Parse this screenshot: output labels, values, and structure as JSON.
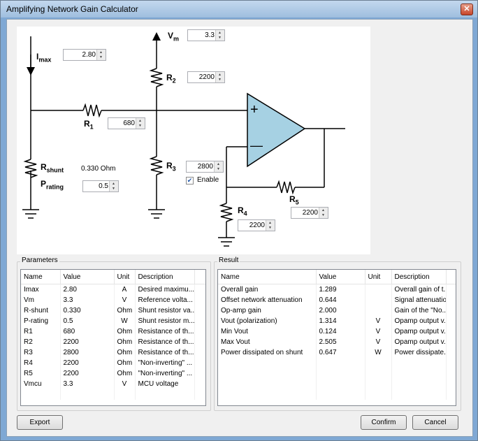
{
  "window": {
    "title": "Amplifying Network Gain Calculator"
  },
  "schematic": {
    "imax": {
      "label": "I",
      "sub": "max",
      "value": "2.80"
    },
    "vm": {
      "label": "V",
      "sub": "m",
      "value": "3.3"
    },
    "r1": {
      "label": "R",
      "sub": "1",
      "value": "680"
    },
    "r2": {
      "label": "R",
      "sub": "2",
      "value": "2200"
    },
    "r3": {
      "label": "R",
      "sub": "3",
      "value": "2800"
    },
    "r4": {
      "label": "R",
      "sub": "4",
      "value": "2200"
    },
    "r5": {
      "label": "R",
      "sub": "5",
      "value": "2200"
    },
    "rshunt": {
      "label": "R",
      "sub": "shunt",
      "value_text": "0.330 Ohm"
    },
    "prating": {
      "label": "P",
      "sub": "rating",
      "value": "0.5"
    },
    "enable": {
      "label": "Enable",
      "checked": true
    },
    "opamp": {
      "plus": "+",
      "minus": "—"
    }
  },
  "parameters": {
    "title": "Parameters",
    "columns": [
      "Name",
      "Value",
      "Unit",
      "Description"
    ],
    "rows": [
      [
        "Imax",
        "2.80",
        "A",
        "Desired maximu..."
      ],
      [
        "Vm",
        "3.3",
        "V",
        "Reference volta..."
      ],
      [
        "R-shunt",
        "0.330",
        "Ohm",
        "Shunt resistor va..."
      ],
      [
        "P-rating",
        "0.5",
        "W",
        "Shunt resistor m..."
      ],
      [
        "R1",
        "680",
        "Ohm",
        "Resistance of th..."
      ],
      [
        "R2",
        "2200",
        "Ohm",
        "Resistance of th..."
      ],
      [
        "R3",
        "2800",
        "Ohm",
        "Resistance of th..."
      ],
      [
        "R4",
        "2200",
        "Ohm",
        "\"Non-inverting\" ..."
      ],
      [
        "R5",
        "2200",
        "Ohm",
        "\"Non-inverting\" ..."
      ],
      [
        "Vmcu",
        "3.3",
        "V",
        "MCU voltage"
      ]
    ]
  },
  "result": {
    "title": "Result",
    "columns": [
      "Name",
      "Value",
      "Unit",
      "Description"
    ],
    "rows": [
      [
        "Overall gain",
        "1.289",
        "",
        "Overall gain of t..."
      ],
      [
        "Offset network attenuation",
        "0.644",
        "",
        "Signal attenuatio..."
      ],
      [
        "Op-amp gain",
        "2.000",
        "",
        "Gain of the \"No..."
      ],
      [
        "Vout (polarization)",
        "1.314",
        "V",
        "Opamp output v..."
      ],
      [
        "Min Vout",
        "0.124",
        "V",
        "Opamp output v..."
      ],
      [
        "Max Vout",
        "2.505",
        "V",
        "Opamp output v..."
      ],
      [
        "Power dissipated on shunt",
        "0.647",
        "W",
        "Power dissipate..."
      ]
    ]
  },
  "buttons": {
    "export": "Export",
    "confirm": "Confirm",
    "cancel": "Cancel"
  },
  "colors": {
    "opamp_fill": "#a6d1e3",
    "title_gradient_top": "#c3d8ee"
  }
}
